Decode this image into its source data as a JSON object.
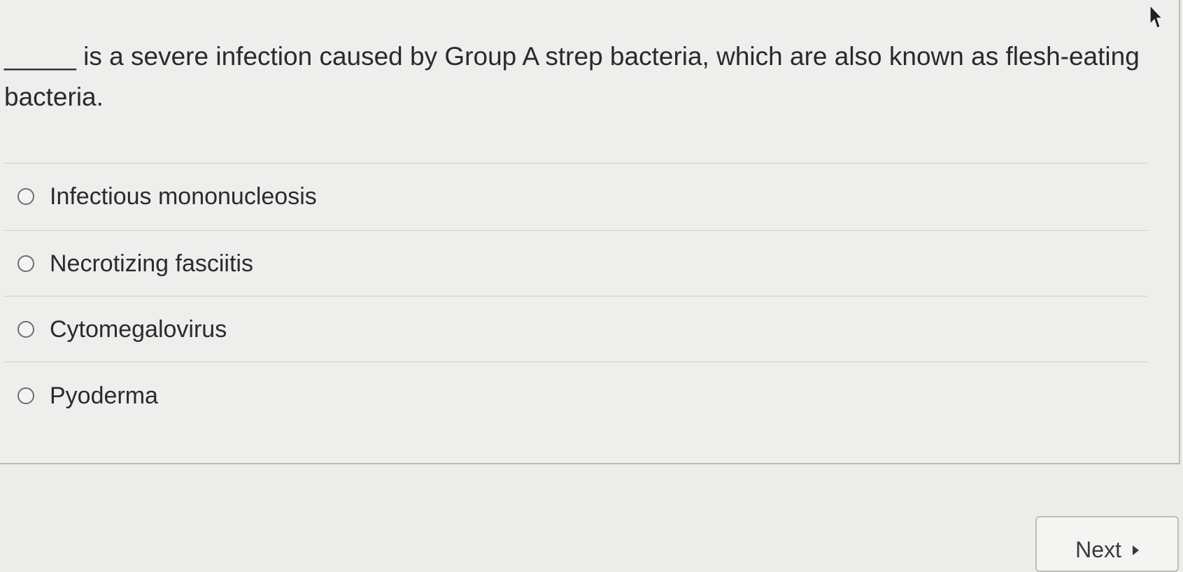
{
  "question": {
    "blank": "_____",
    "text": "is a severe infection caused by Group A strep bacteria, which are also known as flesh-eating bacteria."
  },
  "options": [
    {
      "label": "Infectious mononucleosis",
      "selected": false
    },
    {
      "label": "Necrotizing fasciitis",
      "selected": false
    },
    {
      "label": "Cytomegalovirus",
      "selected": false
    },
    {
      "label": "Pyoderma",
      "selected": false
    }
  ],
  "navigation": {
    "next_label": "Next"
  },
  "icons": {
    "cursor": "mouse-pointer-icon",
    "next_arrow": "triangle-right-icon"
  }
}
